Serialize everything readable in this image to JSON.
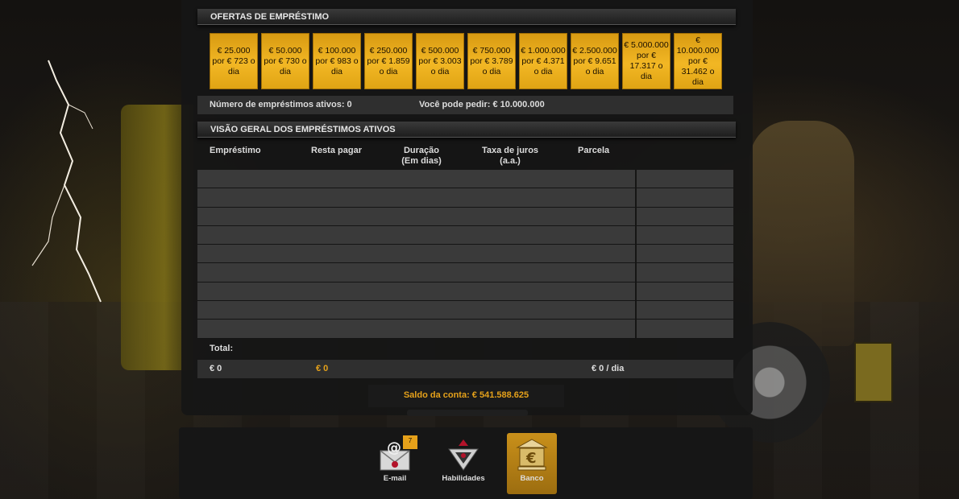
{
  "offers_header": "OFERTAS DE EMPRÉSTIMO",
  "offers": [
    {
      "amount": "€ 25.000",
      "rate": "por € 723 o",
      "unit": "dia"
    },
    {
      "amount": "€ 50.000",
      "rate": "por € 730 o",
      "unit": "dia"
    },
    {
      "amount": "€ 100.000",
      "rate": "por € 983 o",
      "unit": "dia"
    },
    {
      "amount": "€ 250.000",
      "rate": "por € 1.859",
      "unit": "o dia"
    },
    {
      "amount": "€ 500.000",
      "rate": "por € 3.003",
      "unit": "o dia"
    },
    {
      "amount": "€ 750.000",
      "rate": "por € 3.789",
      "unit": "o dia"
    },
    {
      "amount": "€ 1.000.000",
      "rate": "por € 4.371",
      "unit": "o dia"
    },
    {
      "amount": "€ 2.500.000",
      "rate": "por € 9.651",
      "unit": "o dia"
    },
    {
      "amount": "€ 5.000.000",
      "rate": "por € 17.317 o",
      "unit": "dia"
    },
    {
      "amount": "€ 10.000.000",
      "rate": "por € 31.462 o",
      "unit": "dia"
    }
  ],
  "info": {
    "active_loans": "Número de empréstimos ativos: 0",
    "can_borrow": "Você pode pedir: € 10.000.000"
  },
  "overview_header": "VISÃO GERAL DOS EMPRÉSTIMOS ATIVOS",
  "columns": {
    "loan": "Empréstimo",
    "remaining": "Resta pagar",
    "duration_1": "Duração",
    "duration_2": "(Em dias)",
    "rate_1": "Taxa de juros",
    "rate_2": "(a.a.)",
    "installment": "Parcela"
  },
  "total": {
    "label": "Total:",
    "loan": "€ 0",
    "remaining": "€ 0",
    "installment": "€ 0 / dia"
  },
  "balance": "Saldo da conta: € 541.588.625",
  "nav": {
    "email_label": "E-mail",
    "email_badge": "7",
    "skills_label": "Habilidades",
    "bank_label": "Banco"
  },
  "colors": {
    "accent": "#f2b724",
    "balance": "#e5a11a"
  }
}
